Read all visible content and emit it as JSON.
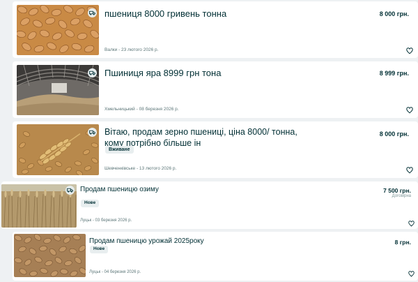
{
  "listings": [
    {
      "title": "пшениця 8000 гривень тонна",
      "price": "8 000 грн.",
      "location_date": "Валки - 23 лютого 2026 р."
    },
    {
      "title": "Пшиниця яра 8999 грн тона",
      "price": "8 999 грн.",
      "location_date": "Хмельницький - 08 березня 2026 р."
    },
    {
      "title": "Вітаю, продам зерно пшениці, ціна 8000/ тонна, кому потрібно більше ін",
      "price": "8 000 грн.",
      "condition": "Вживане",
      "location_date": "Шевченківське - 13 лютого 2026 р."
    },
    {
      "title": "Продам пшеницю озиму",
      "price": "7 500 грн.",
      "price_note": "Договірна",
      "condition": "Нове",
      "location_date": "Луцьк - 03 березня 2026 р."
    },
    {
      "title": "Продам пшеницю урожай 2025року",
      "price": "8 грн.",
      "condition": "Нове",
      "location_date": "Луцьк - 04 березня 2026 р."
    }
  ],
  "icons": {
    "delivery": "truck-icon",
    "favorite": "heart-outline-icon"
  },
  "colors": {
    "page_bg": "#eef1f3",
    "card_bg": "#ffffff",
    "text": "#002f34",
    "muted": "#7f9799"
  }
}
